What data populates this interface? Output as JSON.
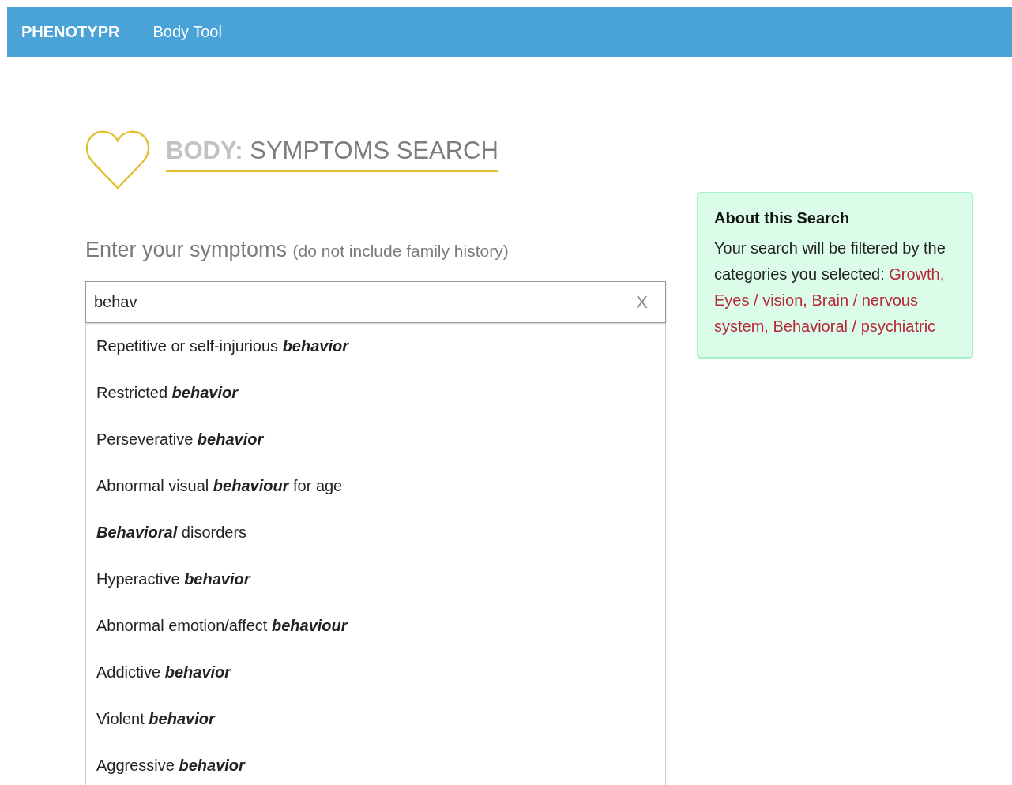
{
  "navbar": {
    "brand": "PHENOTYPR",
    "links": [
      {
        "label": "Body Tool"
      }
    ]
  },
  "heading": {
    "prefix": "BODY:",
    "title": "SYMPTOMS SEARCH"
  },
  "search": {
    "label": "Enter your symptoms",
    "hint": "(do not include family history)",
    "value": "behav",
    "clear": "X",
    "suggestions": [
      {
        "label": "Repetitive or self-injurious **behavior**"
      },
      {
        "label": "Restricted **behavior**"
      },
      {
        "label": "Perseverative **behavior**"
      },
      {
        "label": "Abnormal visual **behaviour** for age"
      },
      {
        "label": "**Behavioral** disorders"
      },
      {
        "label": "Hyperactive **behavior**"
      },
      {
        "label": "Abnormal emotion/affect **behaviour**"
      },
      {
        "label": "Addictive **behavior**"
      },
      {
        "label": "Violent **behavior**"
      },
      {
        "label": "Aggressive **behavior**"
      }
    ]
  },
  "about": {
    "title": "About this Search",
    "text": "Your search will be filtered by the categories you selected:",
    "categories": "Growth, Eyes / vision, Brain / nervous system, Behavioral / psychiatric"
  }
}
